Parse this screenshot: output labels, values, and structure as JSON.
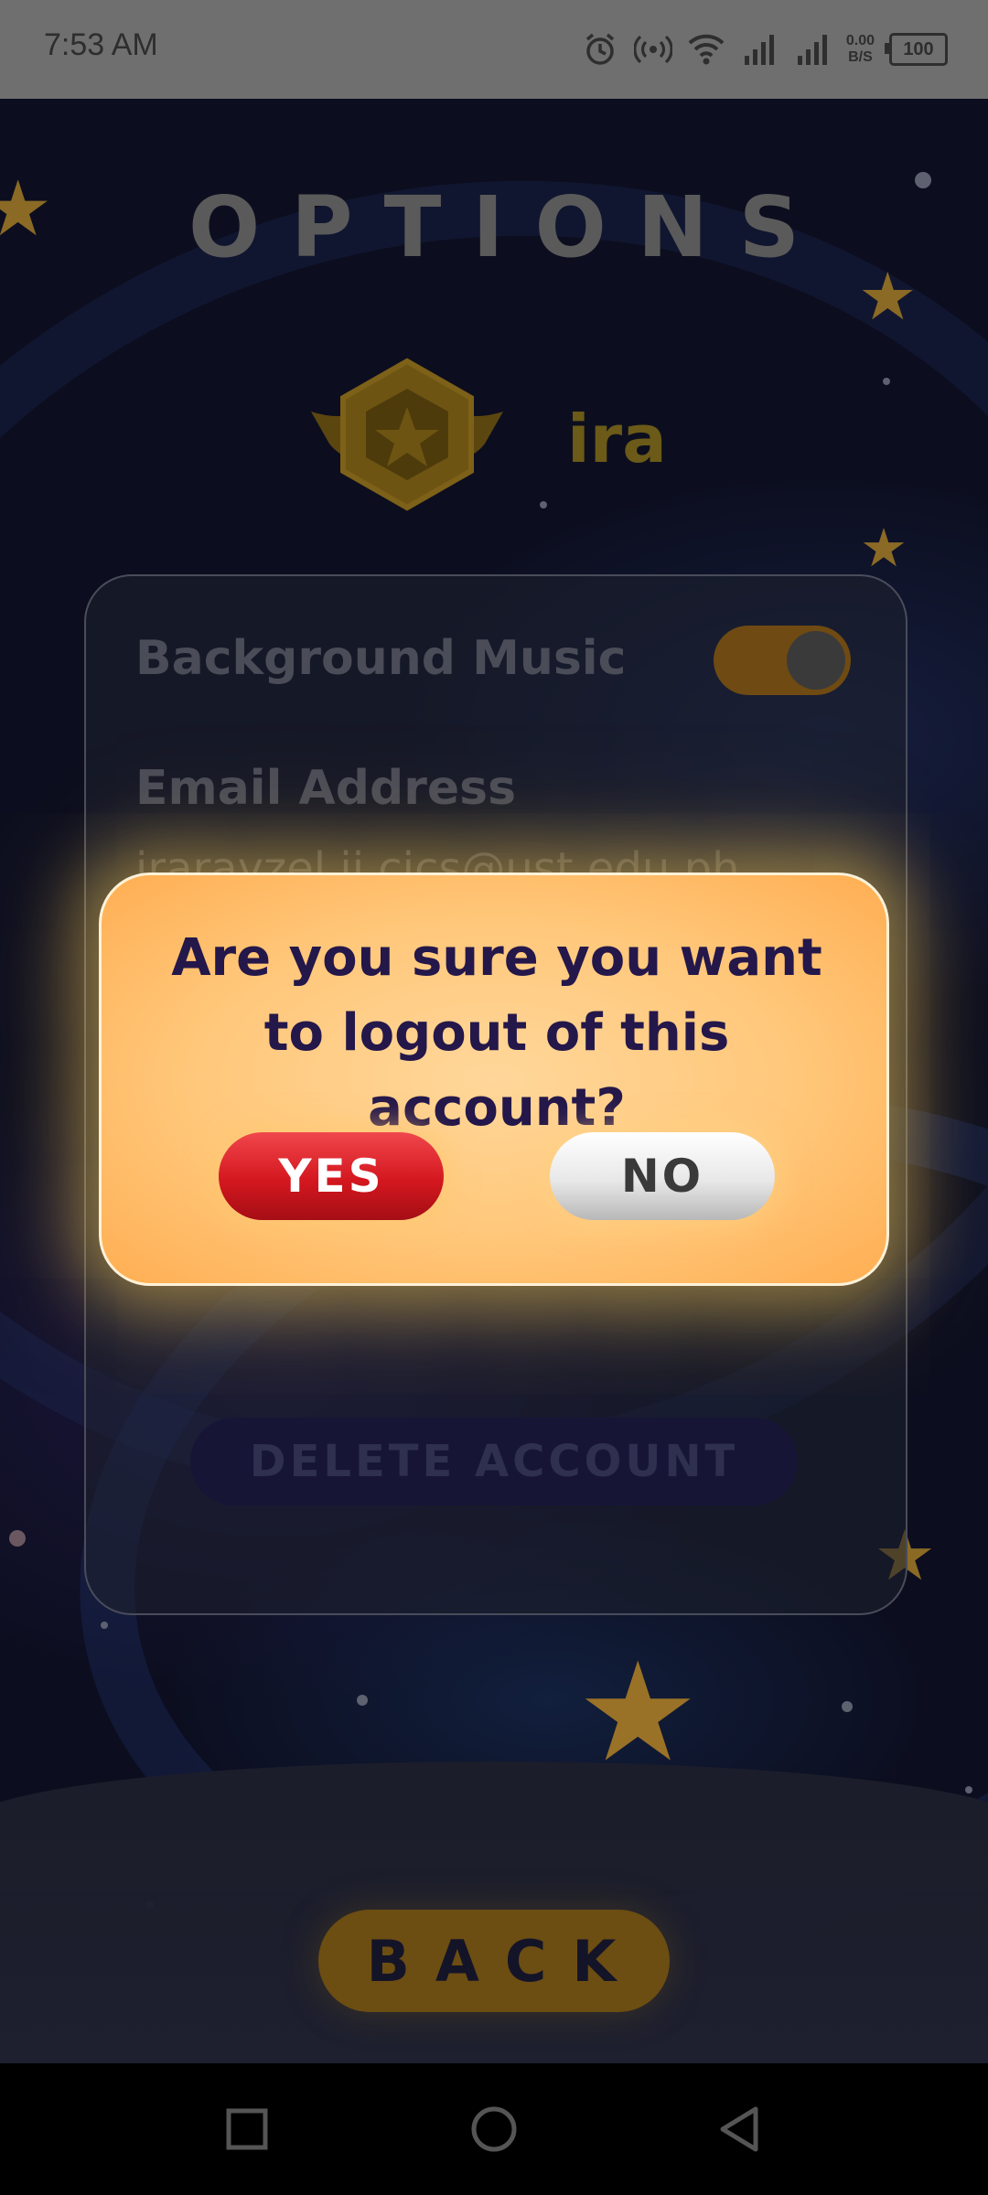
{
  "status_bar": {
    "time": "7:53 AM",
    "speed_value": "0.00",
    "speed_unit": "B/S",
    "battery": "100",
    "icons": [
      "alarm-icon",
      "hotspot-icon",
      "wifi-icon",
      "signal-icon",
      "signal-icon"
    ]
  },
  "screen": {
    "title": "OPTIONS",
    "username": "ira",
    "background_music_label": "Background Music",
    "background_music_on": true,
    "email_label": "Email Address",
    "email_value": "irarayzel.ji.cics@ust.edu.ph",
    "delete_account_label": "DELETE ACCOUNT",
    "back_label": "BACK"
  },
  "dialog": {
    "message": "Are you sure you want to logout of this account?",
    "yes_label": "YES",
    "no_label": "NO"
  },
  "navbar": {
    "icons": [
      "recents-icon",
      "home-icon",
      "back-icon"
    ]
  },
  "colors": {
    "dialog_bg": "#ffc77a",
    "dialog_text": "#24174a",
    "yes_button": "#d4171f",
    "no_button": "#e8e8e8"
  }
}
